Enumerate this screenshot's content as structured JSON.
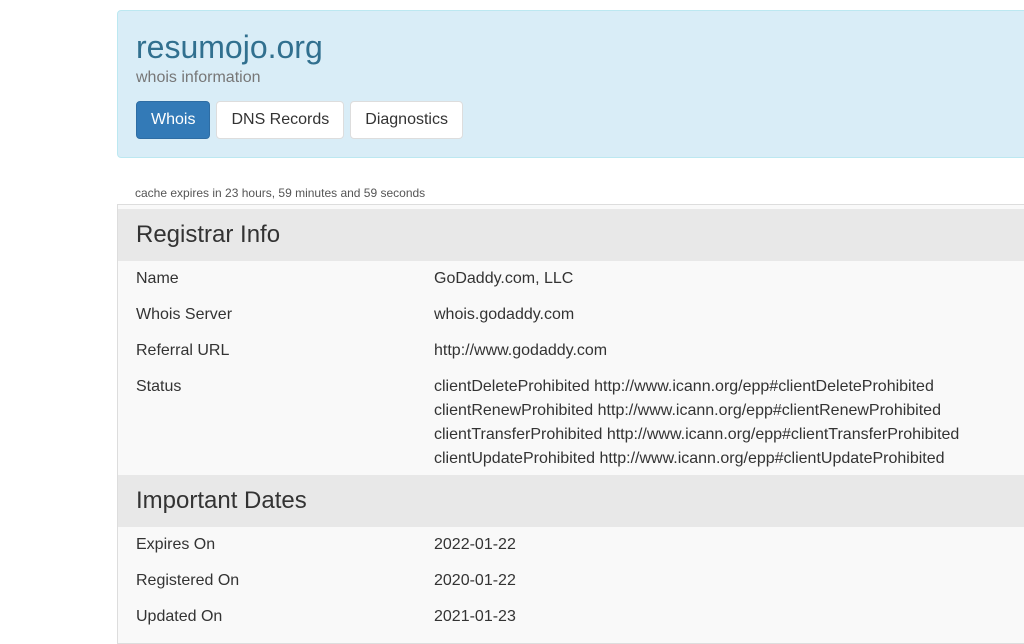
{
  "header": {
    "title": "resumojo.org",
    "subtitle": "whois information",
    "tabs": [
      {
        "label": "Whois",
        "active": true
      },
      {
        "label": "DNS Records",
        "active": false
      },
      {
        "label": "Diagnostics",
        "active": false
      }
    ]
  },
  "cache_note": "cache expires in 23 hours, 59 minutes and 59 seconds",
  "registrar": {
    "heading": "Registrar Info",
    "name_label": "Name",
    "name_value": "GoDaddy.com, LLC",
    "whois_label": "Whois Server",
    "whois_value": "whois.godaddy.com",
    "referral_label": "Referral URL",
    "referral_value": "http://www.godaddy.com",
    "status_label": "Status",
    "status_lines": [
      "clientDeleteProhibited http://www.icann.org/epp#clientDeleteProhibited",
      "clientRenewProhibited http://www.icann.org/epp#clientRenewProhibited",
      "clientTransferProhibited http://www.icann.org/epp#clientTransferProhibited",
      "clientUpdateProhibited http://www.icann.org/epp#clientUpdateProhibited"
    ]
  },
  "dates": {
    "heading": "Important Dates",
    "expires_label": "Expires On",
    "expires_value": "2022-01-22",
    "registered_label": "Registered On",
    "registered_value": "2020-01-22",
    "updated_label": "Updated On",
    "updated_value": "2021-01-23"
  },
  "colors": {
    "jumbotron_bg": "#d9edf7",
    "title": "#31708f",
    "active_tab": "#337ab7",
    "section_header_bg": "#e8e8e8"
  }
}
